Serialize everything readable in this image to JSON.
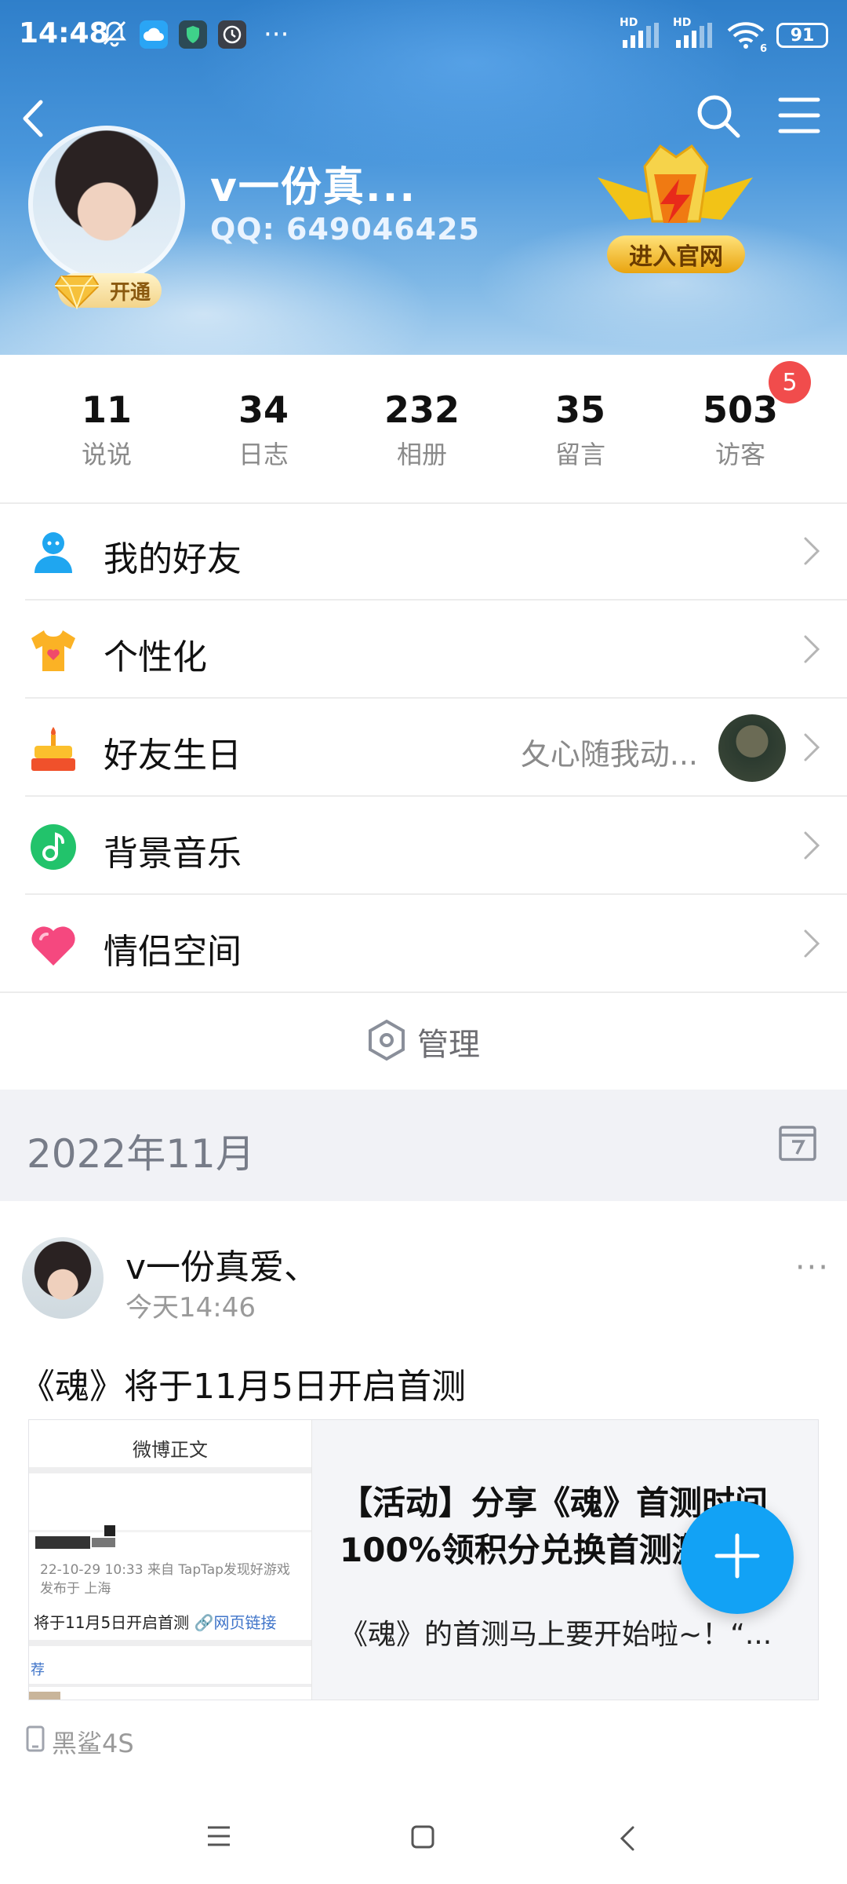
{
  "status_bar": {
    "time": "14:48",
    "dots": "···",
    "signal1_tag": "HD",
    "signal2_tag": "HD",
    "wifi_tag": "6",
    "battery": "91"
  },
  "profile": {
    "nickname": "v一份真...",
    "qq_label": "QQ: 649046425",
    "vip_label": "开通",
    "official_site_label": "进入官网"
  },
  "stats": [
    {
      "value": "11",
      "label": "说说"
    },
    {
      "value": "34",
      "label": "日志"
    },
    {
      "value": "232",
      "label": "相册"
    },
    {
      "value": "35",
      "label": "留言"
    },
    {
      "value": "503",
      "label": "访客"
    }
  ],
  "visitor_badge": "5",
  "menu": {
    "friends": "我的好友",
    "personalize": "个性化",
    "birthday": "好友生日",
    "birthday_name": "夂心随我动...",
    "music": "背景音乐",
    "couple": "情侣空间",
    "manage": "管理"
  },
  "month_bar": {
    "title": "2022年11月"
  },
  "post": {
    "author": "v一份真爱、",
    "time": "今天14:46",
    "text": "《魂》将于11月5日开启首测",
    "more": "···",
    "card": {
      "thumb_title": "微博正文",
      "thumb_meta1": "22-10-29 10:33   来自 TapTap发现好游戏",
      "thumb_meta2": "发布于 上海",
      "thumb_main": "将于11月5日开启首测",
      "thumb_link": "网页链接",
      "thumb_tag": "荐",
      "title_line1": "【活动】分享《魂》首测时间",
      "title_line2": "100%领积分兑换首测激",
      "desc": "《魂》的首测马上要开始啦~！“..."
    },
    "device": "黑鲨4S"
  },
  "colors": {
    "accent_blue": "#12a2f5",
    "badge_red": "#f14c4c",
    "month_bar_bg": "#f1f2f6"
  }
}
